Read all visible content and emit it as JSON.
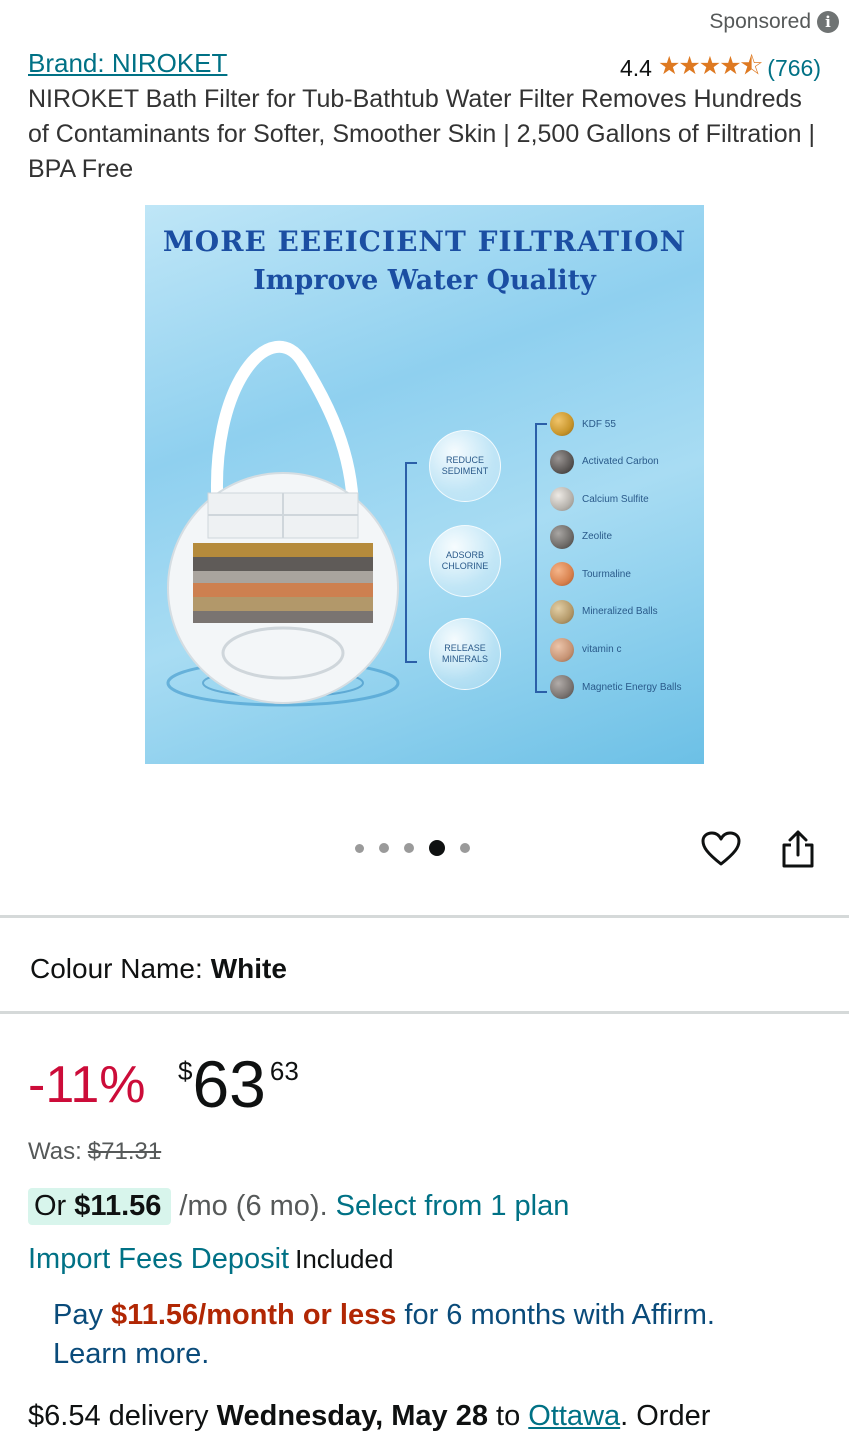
{
  "header": {
    "sponsored_label": "Sponsored",
    "brand_link": "Brand: NIROKET",
    "rating_value": "4.4",
    "rating_stars": 4.4,
    "rating_count": "(766)",
    "product_title": "NIROKET Bath Filter for Tub-Bathtub Water Filter Removes Hundreds of Contaminants for Softer, Smoother Skin | 2,500 Gallons of Filtration | BPA Free"
  },
  "image": {
    "heading": "MORE EEEICIENT FILTRATION",
    "subheading": "Improve Water Quality",
    "bubbles": [
      {
        "line1": "REDUCE",
        "line2": "SEDIMENT"
      },
      {
        "line1": "ADSORB",
        "line2": "CHLORINE"
      },
      {
        "line1": "RELEASE",
        "line2": "MINERALS"
      }
    ],
    "layers": [
      {
        "label": "KDF 55",
        "color": "#c9962c"
      },
      {
        "label": "Activated Carbon",
        "color": "#5b5755"
      },
      {
        "label": "Calcium Sulfite",
        "color": "#b7b3ad"
      },
      {
        "label": "Zeolite",
        "color": "#6e6b68"
      },
      {
        "label": "Tourmaline",
        "color": "#d9824e"
      },
      {
        "label": "Mineralized Balls",
        "color": "#b59a6a"
      },
      {
        "label": "vitamin c",
        "color": "#c79475"
      },
      {
        "label": "Magnetic Energy Balls",
        "color": "#7a7471"
      }
    ]
  },
  "carousel": {
    "total": 5,
    "active_index": 3
  },
  "colour": {
    "label": "Colour Name:",
    "value": "White"
  },
  "pricing": {
    "discount": "-11%",
    "currency": "$",
    "whole": "63",
    "fraction": "63",
    "was_label": "Was:",
    "was_price": "$71.31",
    "monthly_prefix": "Or ",
    "monthly_amount": "$11.56",
    "monthly_suffix": " /mo (6 mo).",
    "plan_link": "Select from 1 plan",
    "import_link": "Import Fees Deposit",
    "import_status": "Included",
    "affirm_pre": "Pay ",
    "affirm_amount": "$11.56/month or less",
    "affirm_post": " for 6 months with Affirm.",
    "affirm_link": "Learn more."
  },
  "delivery": {
    "cost": "$6.54 delivery ",
    "date": "Wednesday, May 28",
    "to": " to ",
    "city": "Ottawa",
    "tail": ". Order"
  },
  "colors": {
    "link": "#007185",
    "discount": "#cc0c39",
    "star": "#de7921",
    "affirm_amount": "#b12704"
  }
}
